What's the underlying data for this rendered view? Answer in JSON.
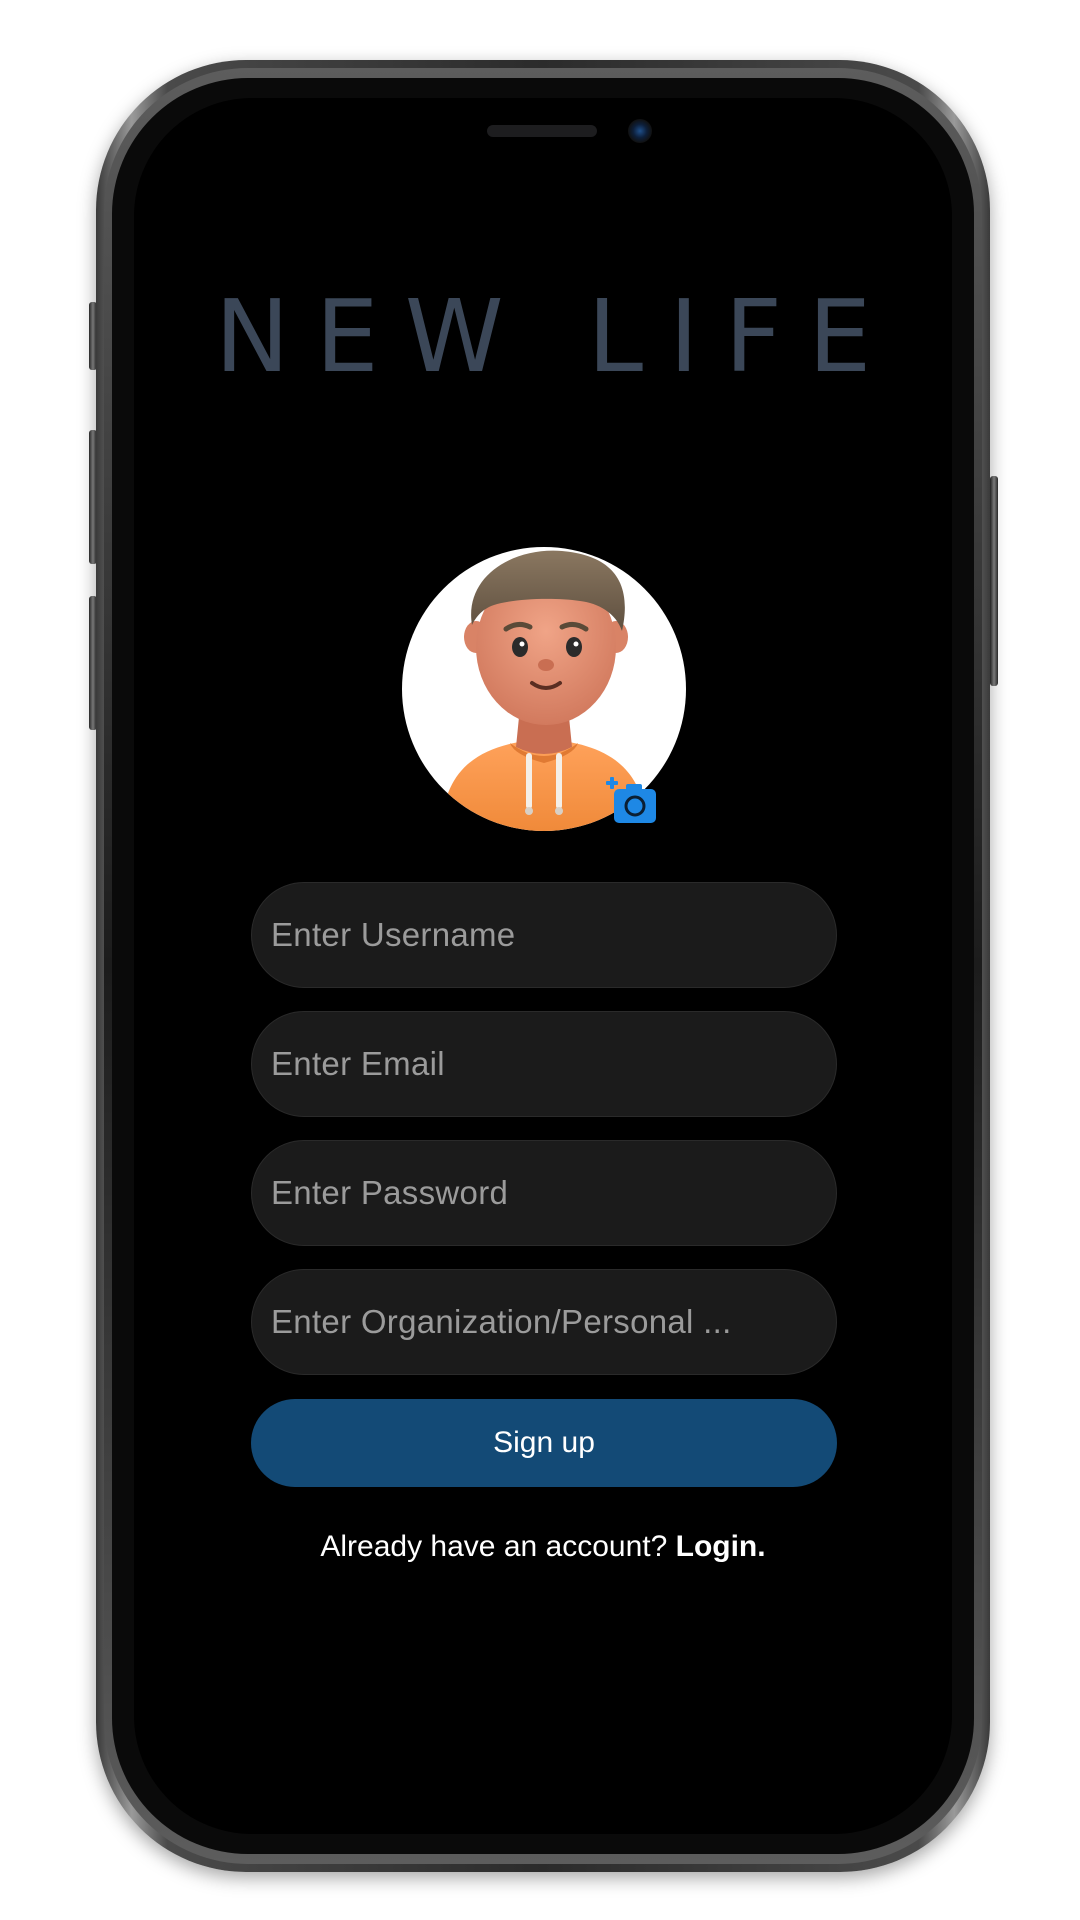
{
  "app": {
    "title": "NEW LIFE"
  },
  "avatar": {
    "icon": "user-avatar-illustration",
    "add_photo_icon": "add-photo-icon"
  },
  "form": {
    "username_placeholder": "Enter Username",
    "email_placeholder": "Enter Email",
    "password_placeholder": "Enter Password",
    "organization_placeholder": "Enter Organization/Personal ..."
  },
  "actions": {
    "signup_label": "Sign up",
    "footer_prompt": "Already have an account?",
    "login_label": "Login."
  },
  "colors": {
    "background": "#000000",
    "title": "#3b4758",
    "field": "#1b1b1b",
    "primary_button": "#134a76",
    "accent_icon": "#1e88e5"
  }
}
